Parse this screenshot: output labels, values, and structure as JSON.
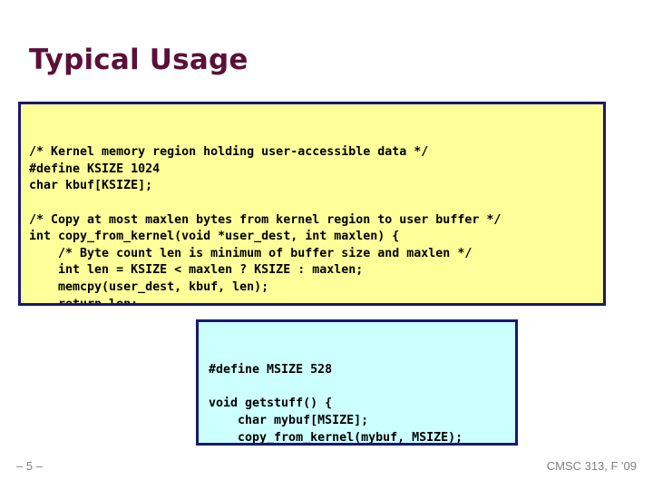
{
  "slide": {
    "title": "Typical Usage",
    "title_color": "#5C1038",
    "background_color": "#FFFFFF"
  },
  "code_blocks": [
    {
      "id": "kernel-code-block",
      "background_color": "#FFFF99",
      "border_color": "#191970",
      "text_color": "#000000",
      "code": "/* Kernel memory region holding user-accessible data */\n#define KSIZE 1024\nchar kbuf[KSIZE];\n\n/* Copy at most maxlen bytes from kernel region to user buffer */\nint copy_from_kernel(void *user_dest, int maxlen) {\n    /* Byte count len is minimum of buffer size and maxlen */\n    int len = KSIZE < maxlen ? KSIZE : maxlen;\n    memcpy(user_dest, kbuf, len);\n    return len;\n}"
    },
    {
      "id": "user-code-block",
      "background_color": "#CCFFFF",
      "border_color": "#191970",
      "text_color": "#000000",
      "code": "#define MSIZE 528\n\nvoid getstuff() {\n    char mybuf[MSIZE];\n    copy_from_kernel(mybuf, MSIZE);\n    printf(“%s\\n”, mybuf);\n}"
    }
  ],
  "footer": {
    "page_marker": "– 5 –",
    "course": "CMSC 313, F '09",
    "text_color": "#808080"
  }
}
